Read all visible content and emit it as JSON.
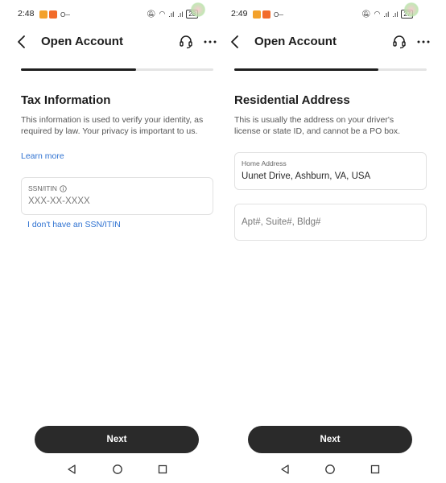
{
  "screens": [
    {
      "status": {
        "time": "2:48",
        "battery": "28"
      },
      "header": {
        "title": "Open Account"
      },
      "progress": 0.6,
      "section": {
        "title": "Tax Information",
        "description": "This information is used to verify your identity, as required by law. Your privacy is important to us.",
        "learn_more": "Learn more"
      },
      "ssn_field": {
        "label": "SSN/ITIN",
        "placeholder": "XXX-XX-XXXX"
      },
      "no_ssn_link": "I don't have an SSN/ITIN",
      "next_label": "Next"
    },
    {
      "status": {
        "time": "2:49",
        "battery": "27"
      },
      "header": {
        "title": "Open Account"
      },
      "progress": 0.75,
      "section": {
        "title": "Residential Address",
        "description": "This is usually the address on your driver's license or state ID, and cannot be a PO box."
      },
      "home_address": {
        "label": "Home Address",
        "value": "Uunet Drive, Ashburn, VA, USA"
      },
      "apt_field": {
        "placeholder": "Apt#, Suite#, Bldg#"
      },
      "next_label": "Next"
    }
  ],
  "icons": {
    "back": "chevron-left-icon",
    "support": "headset-icon",
    "more": "more-horizontal-icon",
    "info": "info-icon",
    "nav_back": "triangle-back-icon",
    "nav_home": "circle-home-icon",
    "nav_recent": "square-recents-icon"
  },
  "colors": {
    "link": "#2f72d1",
    "button": "#2a2a2a",
    "progress_fill": "#1e1e1e",
    "progress_track": "#e4e4e4"
  }
}
